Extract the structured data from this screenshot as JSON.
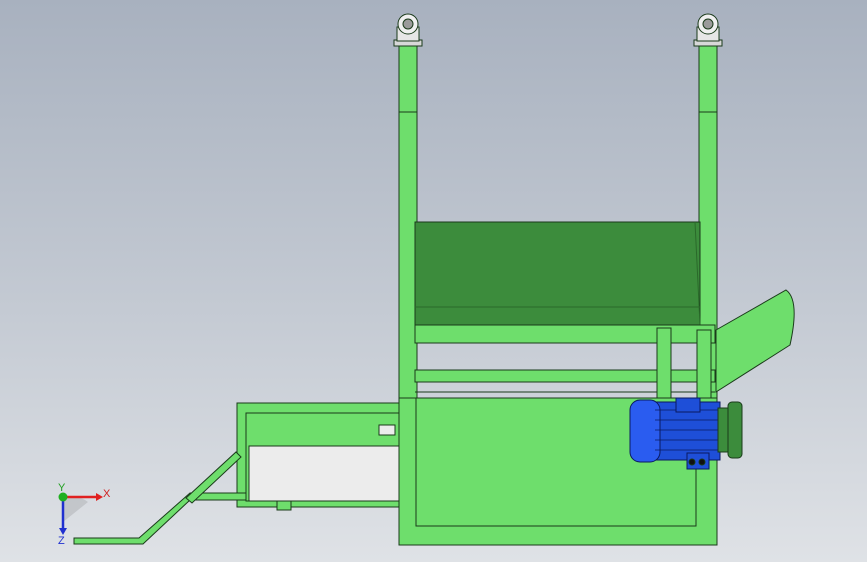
{
  "triad": {
    "x_label": "X",
    "y_label": "Y",
    "z_label": "Z"
  },
  "colors": {
    "frame_green": "#6ede6c",
    "dark_green": "#3c8c3c",
    "outline": "#1a3a1a",
    "motor_blue": "#1e4fd8",
    "axis_x": "#e02020",
    "axis_y": "#20b020",
    "axis_z": "#2030d0"
  }
}
